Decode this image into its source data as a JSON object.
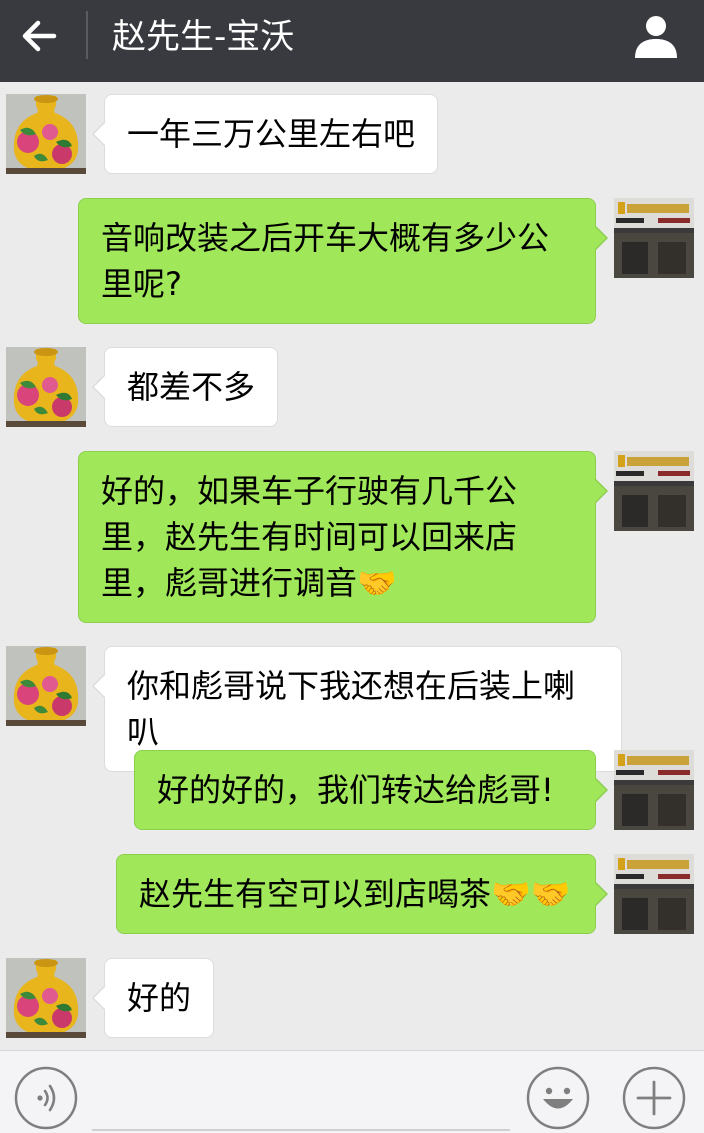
{
  "header": {
    "back_icon": "arrow-left-icon",
    "title": "赵先生-宝沃",
    "profile_icon": "person-icon"
  },
  "messages": [
    {
      "from": "contact",
      "text": "一年三万公里左右吧"
    },
    {
      "from": "me",
      "text": "音响改装之后开车大概有多少公里呢?"
    },
    {
      "from": "contact",
      "text": "都差不多"
    },
    {
      "from": "me",
      "text": "好的，如果车子行驶有几千公里，赵先生有时间可以回来店里，彪哥进行调音🤝"
    },
    {
      "from": "contact",
      "text": "你和彪哥说下我还想在后装上喇叭"
    },
    {
      "from": "me",
      "text": "好的好的，我们转达给彪哥!"
    },
    {
      "from": "me",
      "text": "赵先生有空可以到店喝茶🤝🤝"
    },
    {
      "from": "contact",
      "text": "好的"
    }
  ],
  "avatars": {
    "contact": "vase-photo-avatar",
    "me": "shop-storefront-avatar",
    "shop_sign_visible_text": "美歌 DYNAUDIO"
  },
  "toolbar": {
    "voice_icon": "voice-icon",
    "emoji_icon": "smiley-icon",
    "more_icon": "plus-icon"
  },
  "colors": {
    "header_bg": "#393a3f",
    "chat_bg": "#ebebeb",
    "incoming_bubble": "#ffffff",
    "outgoing_bubble": "#a0e75a",
    "toolbar_bg": "#f4f4f6"
  }
}
